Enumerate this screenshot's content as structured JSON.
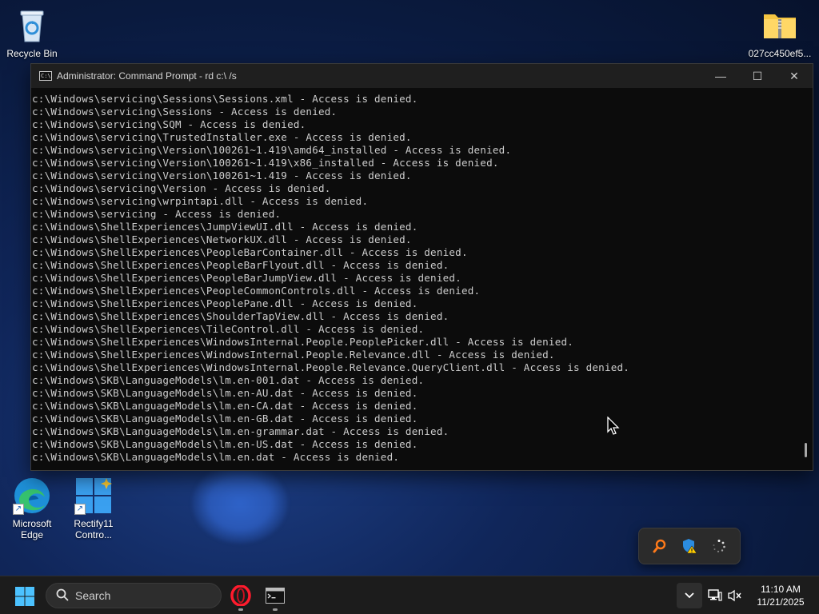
{
  "desktop": {
    "icons": [
      {
        "label": "Recycle Bin"
      },
      {
        "label": "027cc450ef5..."
      },
      {
        "label": "Microsoft Edge"
      },
      {
        "label": "Rectify11 Contro..."
      }
    ]
  },
  "cmd_window": {
    "title": "Administrator: Command Prompt - rd  c:\\ /s",
    "app_icon_text": "C:\\",
    "minimize_glyph": "—",
    "maximize_glyph": "☐",
    "close_glyph": "✕",
    "lines": [
      "c:\\Windows\\servicing\\Sessions\\Sessions.xml - Access is denied.",
      "c:\\Windows\\servicing\\Sessions - Access is denied.",
      "c:\\Windows\\servicing\\SQM - Access is denied.",
      "c:\\Windows\\servicing\\TrustedInstaller.exe - Access is denied.",
      "c:\\Windows\\servicing\\Version\\100261~1.419\\amd64_installed - Access is denied.",
      "c:\\Windows\\servicing\\Version\\100261~1.419\\x86_installed - Access is denied.",
      "c:\\Windows\\servicing\\Version\\100261~1.419 - Access is denied.",
      "c:\\Windows\\servicing\\Version - Access is denied.",
      "c:\\Windows\\servicing\\wrpintapi.dll - Access is denied.",
      "c:\\Windows\\servicing - Access is denied.",
      "c:\\Windows\\ShellExperiences\\JumpViewUI.dll - Access is denied.",
      "c:\\Windows\\ShellExperiences\\NetworkUX.dll - Access is denied.",
      "c:\\Windows\\ShellExperiences\\PeopleBarContainer.dll - Access is denied.",
      "c:\\Windows\\ShellExperiences\\PeopleBarFlyout.dll - Access is denied.",
      "c:\\Windows\\ShellExperiences\\PeopleBarJumpView.dll - Access is denied.",
      "c:\\Windows\\ShellExperiences\\PeopleCommonControls.dll - Access is denied.",
      "c:\\Windows\\ShellExperiences\\PeoplePane.dll - Access is denied.",
      "c:\\Windows\\ShellExperiences\\ShoulderTapView.dll - Access is denied.",
      "c:\\Windows\\ShellExperiences\\TileControl.dll - Access is denied.",
      "c:\\Windows\\ShellExperiences\\WindowsInternal.People.PeoplePicker.dll - Access is denied.",
      "c:\\Windows\\ShellExperiences\\WindowsInternal.People.Relevance.dll - Access is denied.",
      "c:\\Windows\\ShellExperiences\\WindowsInternal.People.Relevance.QueryClient.dll - Access is denied.",
      "c:\\Windows\\SKB\\LanguageModels\\lm.en-001.dat - Access is denied.",
      "c:\\Windows\\SKB\\LanguageModels\\lm.en-AU.dat - Access is denied.",
      "c:\\Windows\\SKB\\LanguageModels\\lm.en-CA.dat - Access is denied.",
      "c:\\Windows\\SKB\\LanguageModels\\lm.en-GB.dat - Access is denied.",
      "c:\\Windows\\SKB\\LanguageModels\\lm.en-grammar.dat - Access is denied.",
      "c:\\Windows\\SKB\\LanguageModels\\lm.en-US.dat - Access is denied.",
      "c:\\Windows\\SKB\\LanguageModels\\lm.en.dat - Access is denied."
    ]
  },
  "tray_flyout": {
    "items": [
      "search-tool-icon",
      "security-warning-icon",
      "loading-spinner-icon"
    ]
  },
  "taskbar": {
    "search_label": "Search",
    "apps": [
      "opera-browser-icon",
      "command-prompt-icon"
    ],
    "time": "11:10 AM",
    "date": "11/21/2025"
  },
  "colors": {
    "terminal_bg": "#0c0c0c",
    "terminal_text": "#cccccc",
    "taskbar_bg": "#1c1c1c",
    "accent": "#0078d4"
  }
}
